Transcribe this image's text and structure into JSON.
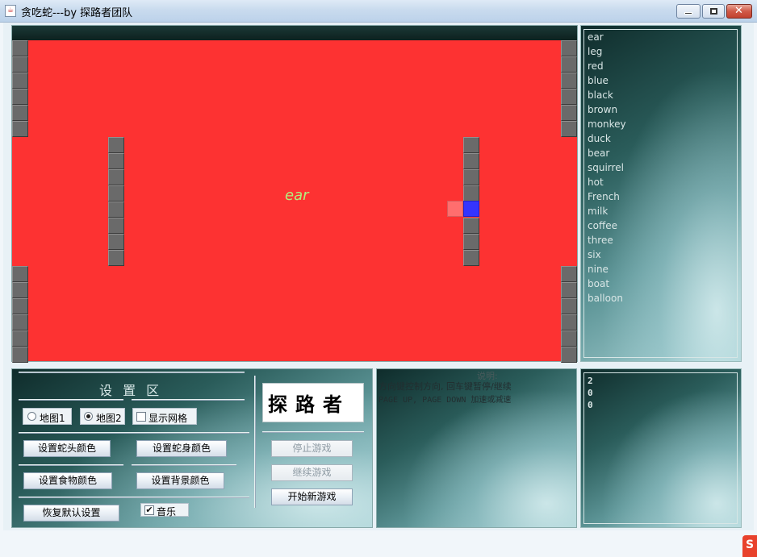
{
  "window": {
    "title": "贪吃蛇---by 探路者团队",
    "icon": "java-cup-icon",
    "close_glyph": "✕"
  },
  "board": {
    "colors": {
      "background": "#fd3232",
      "wall": "#6a6a6a",
      "snake_head": "#3434ff",
      "snake_body": "#ff6e6e",
      "food_text": "#b4ee7e"
    },
    "food_word": "ear"
  },
  "word_list": [
    "ear",
    "leg",
    "red",
    "blue",
    "black",
    "brown",
    "monkey",
    "duck",
    "bear",
    "squirrel",
    "hot",
    "French",
    "milk",
    "coffee",
    "three",
    "six",
    "nine",
    "boat",
    "balloon"
  ],
  "settings": {
    "title": "设 置 区",
    "map1_label": "地图1",
    "map2_label": "地图2",
    "map2_selected": true,
    "show_grid_label": "显示网格",
    "show_grid_checked": false,
    "snake_head_color_btn": "设置蛇头颜色",
    "snake_body_color_btn": "设置蛇身颜色",
    "food_color_btn": "设置食物颜色",
    "background_color_btn": "设置背景颜色",
    "restore_default_btn": "恢复默认设置",
    "music_label": "音乐",
    "music_checked": true,
    "check_glyph": "✔",
    "logo_text": "探路者",
    "stop_game_btn": "停止游戏",
    "continue_game_btn": "继续游戏",
    "new_game_btn": "开始新游戏"
  },
  "instructions": {
    "title": "说明:",
    "line1": "方向键控制方向, 回车键暂停/继续",
    "line2": "PAGE UP, PAGE DOWN 加速或减速"
  },
  "score": {
    "digits": [
      "2",
      "0",
      "0"
    ]
  },
  "corner_badge": "S"
}
